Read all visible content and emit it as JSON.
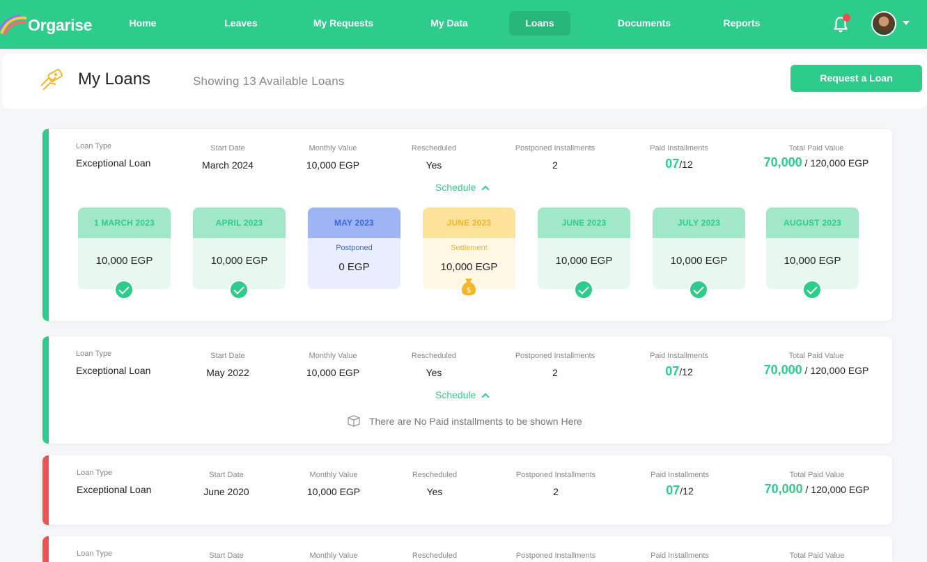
{
  "app": {
    "name": "Orgarise"
  },
  "nav": {
    "items": [
      "Home",
      "Leaves",
      "My Requests",
      "My Data",
      "Loans",
      "Documents",
      "Reports"
    ],
    "active": "Loans"
  },
  "header": {
    "title": "My Loans",
    "subtitle": "Showing 13 Available Loans",
    "request_button": "Request a Loan"
  },
  "labels": {
    "loan_type": "Loan Type",
    "start_date": "Start Date",
    "monthly_value": "Monthly Value",
    "rescheduled": "Rescheduled",
    "postponed_installments": "Postponed Installments",
    "paid_installments": "Paid Installments",
    "total_paid_value": "Total Paid Value",
    "schedule": "Schedule"
  },
  "loans": [
    {
      "loan_type": "Exceptional Loan",
      "start_date": "March 2024",
      "monthly_value": "10,000 EGP",
      "rescheduled": "Yes",
      "postponed": "2",
      "paid": "07",
      "paid_total": "/12",
      "total_paid": "70,000",
      "total_value": "/ 120,000 EGP",
      "status_color": "#2ecc8a",
      "installments": [
        {
          "month": "1 MARCH 2023",
          "amount": "10,000 EGP",
          "state": "paid"
        },
        {
          "month": "APRIL 2023",
          "amount": "10,000 EGP",
          "state": "paid"
        },
        {
          "month": "MAY 2023",
          "amount": "0 EGP",
          "state": "postponed",
          "status": "Postponed"
        },
        {
          "month": "JUNE 2023",
          "amount": "10,000 EGP",
          "state": "settle",
          "status": "Settlement"
        },
        {
          "month": "JUNE 2023",
          "amount": "10,000 EGP",
          "state": "paid"
        },
        {
          "month": "JULY 2023",
          "amount": "10,000 EGP",
          "state": "paid"
        },
        {
          "month": "AUGUST 2023",
          "amount": "10,000 EGP",
          "state": "paid"
        }
      ]
    },
    {
      "loan_type": "Exceptional Loan",
      "start_date": "May 2022",
      "monthly_value": "10,000 EGP",
      "rescheduled": "Yes",
      "postponed": "2",
      "paid": "07",
      "paid_total": "/12",
      "total_paid": "70,000",
      "total_value": "/ 120,000 EGP",
      "status_color": "#2ecc8a",
      "empty_message": "There are No Paid installments to be shown Here"
    },
    {
      "loan_type": "Exceptional Loan",
      "start_date": "June 2020",
      "monthly_value": "10,000 EGP",
      "rescheduled": "Yes",
      "postponed": "2",
      "paid": "07",
      "paid_total": "/12",
      "total_paid": "70,000",
      "total_value": "/ 120,000 EGP",
      "status_color": "#f05252"
    },
    {
      "status_color": "#f05252"
    }
  ]
}
